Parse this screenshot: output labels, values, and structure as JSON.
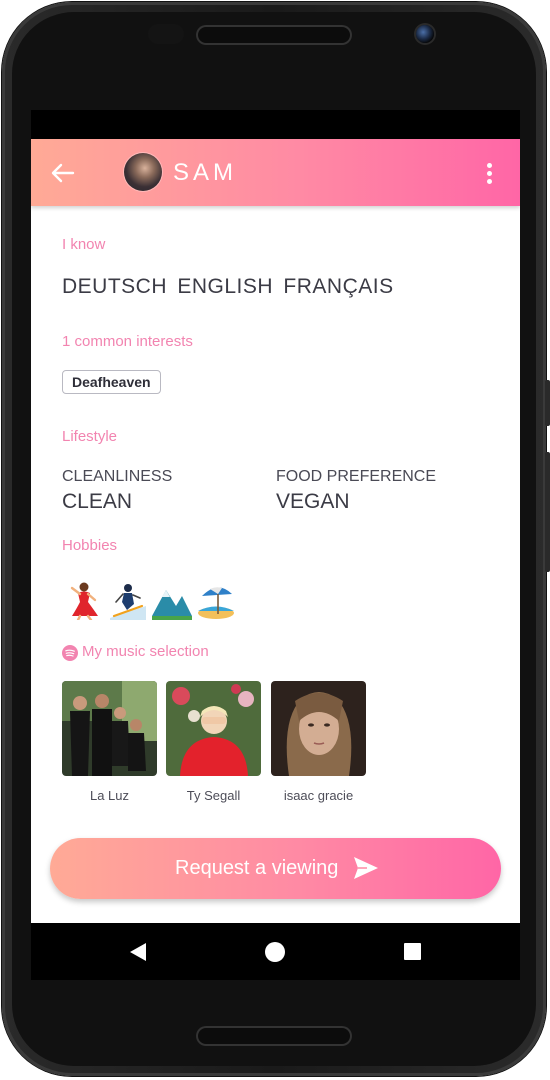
{
  "app": {
    "profile_name": "SAM",
    "colors": {
      "gradient_start": "#ffaa96",
      "gradient_end": "#ff66a6",
      "section_label": "#f284b0",
      "text_dark": "#3b3b45"
    }
  },
  "header": {
    "back_icon": "arrow-left-icon",
    "menu_icon": "more-vertical-icon"
  },
  "languages": {
    "label": "I know",
    "values": [
      "DEUTSCH",
      "ENGLISH",
      "FRANÇAIS"
    ]
  },
  "interests": {
    "label": "1 common interests",
    "tags": [
      "Deafheaven"
    ]
  },
  "lifestyle": {
    "label": "Lifestyle",
    "items": [
      {
        "key": "CLEANLINESS",
        "value": "CLEAN"
      },
      {
        "key": "FOOD PREFERENCE",
        "value": "VEGAN"
      }
    ]
  },
  "hobbies": {
    "label": "Hobbies",
    "icons": [
      "dancer-emoji-icon",
      "skier-emoji-icon",
      "mountains-emoji-icon",
      "beach-umbrella-emoji-icon"
    ]
  },
  "music": {
    "label": "My music selection",
    "icon": "spotify-icon",
    "artists": [
      "La Luz",
      "Ty Segall",
      "isaac gracie"
    ]
  },
  "cta": {
    "label": "Request a viewing",
    "icon": "send-icon"
  },
  "navigation": {
    "icons": [
      "nav-back-icon",
      "nav-home-icon",
      "nav-recents-icon"
    ]
  }
}
